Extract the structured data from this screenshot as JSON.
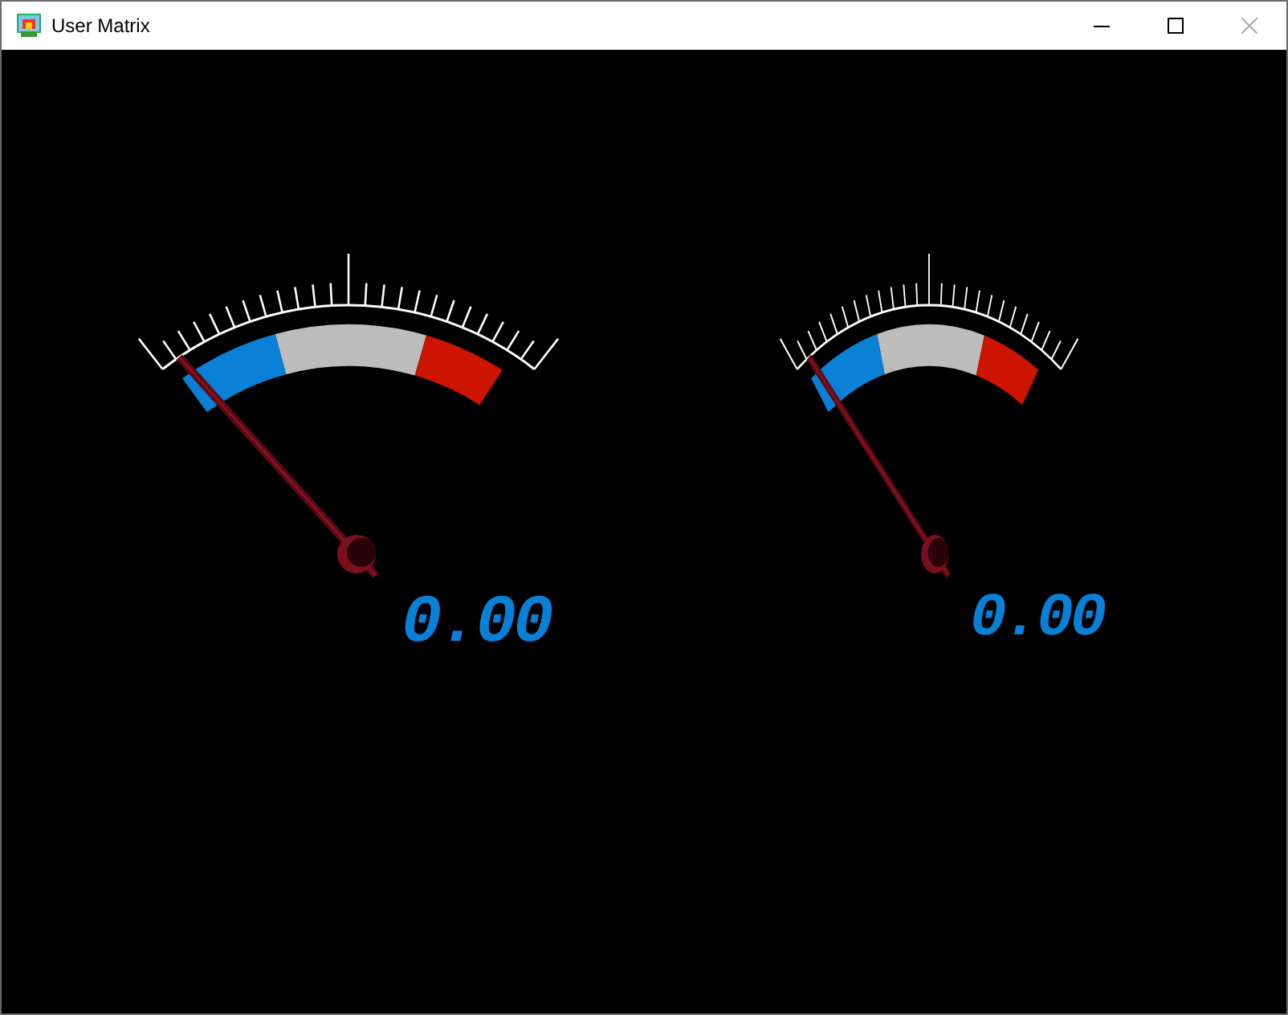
{
  "window": {
    "title": "User Matrix"
  },
  "gauges": [
    {
      "reading": "0.00"
    },
    {
      "reading": "0.00"
    }
  ]
}
